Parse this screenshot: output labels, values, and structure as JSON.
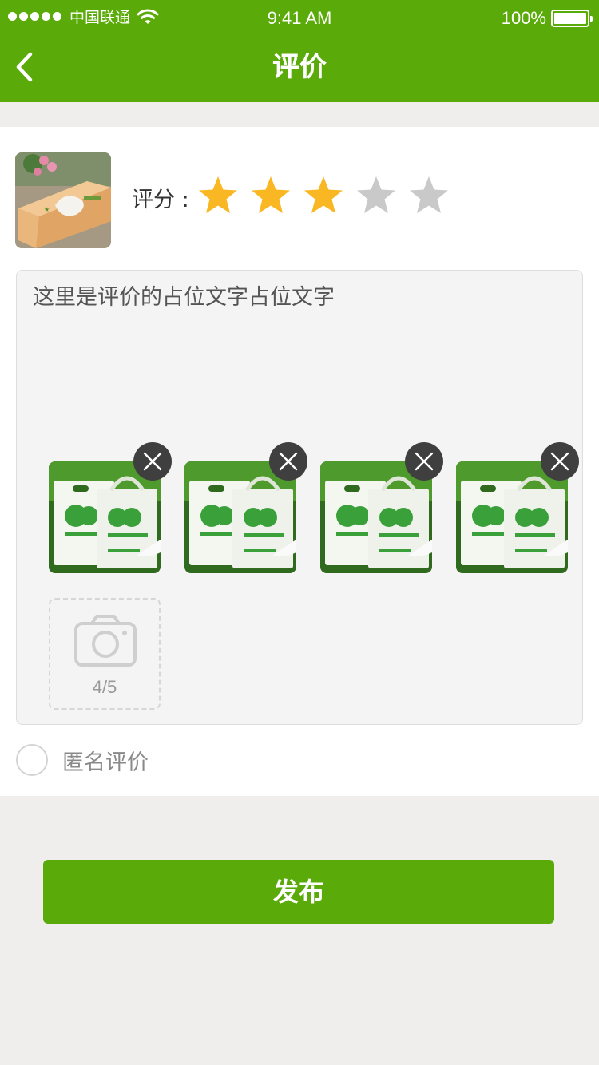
{
  "status_bar": {
    "carrier": "中国联通",
    "time": "9:41 AM",
    "battery": "100%"
  },
  "nav": {
    "title": "评价",
    "back_icon": "chevron-left-icon"
  },
  "product": {
    "image": "tissue-box-product-image"
  },
  "rating": {
    "label": "评分 :",
    "value": 3,
    "max": 5,
    "active_color": "#f9b823",
    "inactive_color": "#c9c9c9"
  },
  "review": {
    "text": "这里是评价的占位文字占位文字"
  },
  "photos": {
    "items": [
      {
        "image": "shopping-bag-photo"
      },
      {
        "image": "shopping-bag-photo"
      },
      {
        "image": "shopping-bag-photo"
      },
      {
        "image": "shopping-bag-photo"
      }
    ],
    "delete_icon": "close-icon",
    "add_icon": "camera-icon",
    "count": "4/5"
  },
  "anonymous": {
    "label": "匿名评价",
    "checked": false
  },
  "publish_button": "发布",
  "colors": {
    "brand_green": "#5aab09",
    "page_bg": "#efeeec"
  }
}
